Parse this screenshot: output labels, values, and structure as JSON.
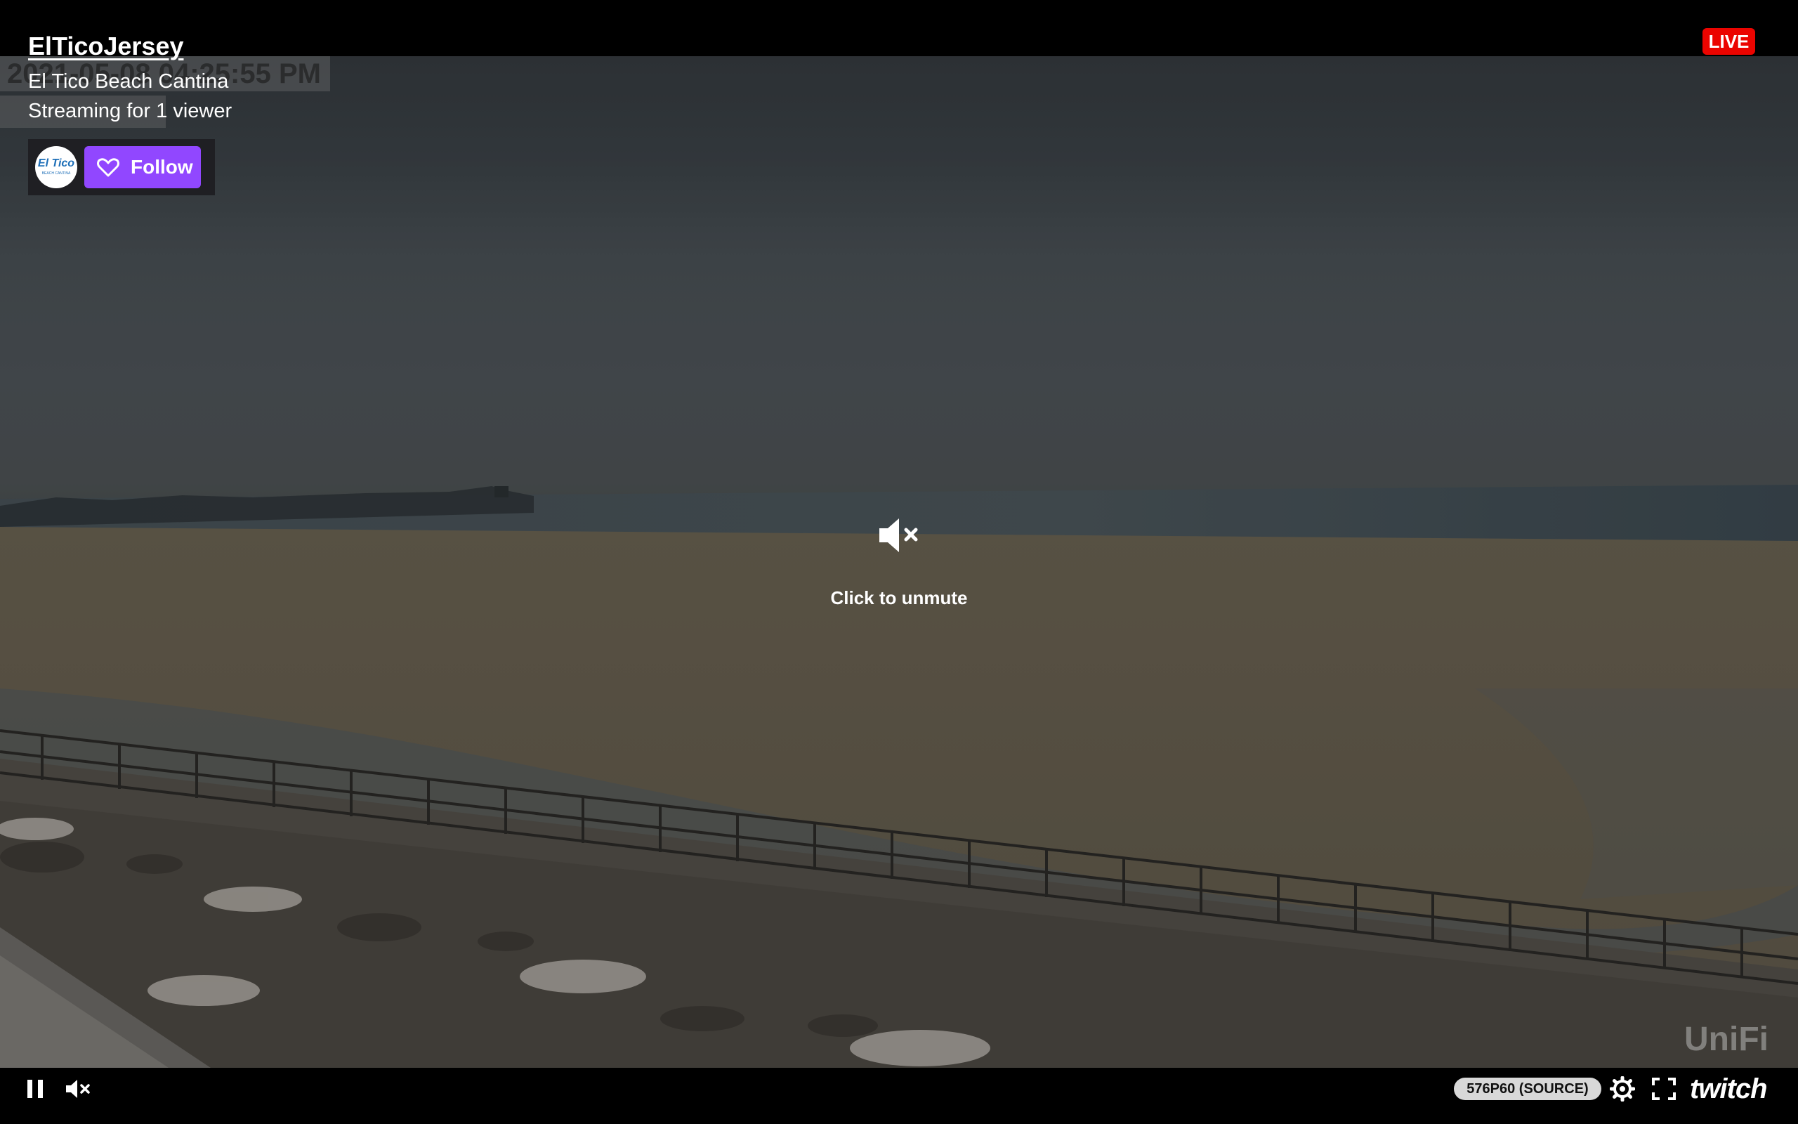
{
  "player": {
    "channel_name": "ElTicoJersey",
    "stream_title": "El Tico Beach Cantina",
    "viewer_text": "Streaming for 1 viewer",
    "follow_label": "Follow",
    "live_label": "LIVE",
    "unmute_label": "Click to unmute",
    "quality_label": "576P60 (SOURCE)",
    "brand_logo": "twitch",
    "avatar_text": "El Tico",
    "avatar_subtext": "BEACH CANTINA",
    "overlay_timestamp": "2021-05-08 04:25:55 PM",
    "watermark": "UniFi"
  },
  "icons": {
    "play_pause": "pause-icon",
    "volume": "volume-muted-icon",
    "settings": "gear-icon",
    "fullscreen": "fullscreen-icon",
    "follow": "heart-icon",
    "unmute": "volume-muted-icon"
  },
  "colors": {
    "accent": "#9147ff",
    "live": "#eb0400",
    "background": "#000000"
  }
}
